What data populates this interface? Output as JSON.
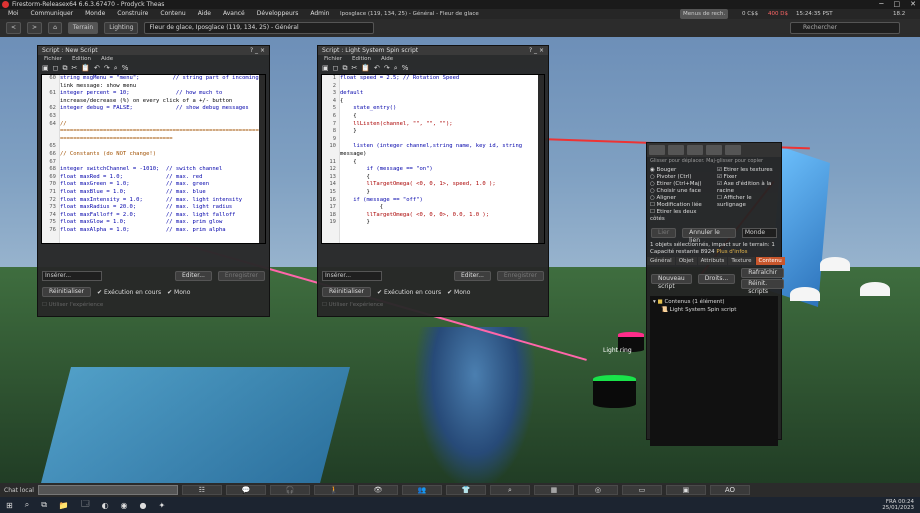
{
  "window_title": "Firestorm-Releasex64 6.6.3.67470 - Prodyck Theas",
  "menu": [
    "Moi",
    "Communiquer",
    "Monde",
    "Construire",
    "Contenu",
    "Aide",
    "Avancé",
    "Développeurs",
    "Admin"
  ],
  "status": {
    "region": "Iposglace (119, 134, 25) - Général - Fleur de glace",
    "search_placeholder": "Menus de rech.",
    "balance": "0 C$$",
    "balance2": "400 D$",
    "time": "15:24:35 PST",
    "fps": "18.2"
  },
  "nav": {
    "back": "<",
    "forward": ">",
    "terrain": "Terrain",
    "lighting": "Lighting",
    "location": "Fleur de glace, Iposglace (119, 134, 25) - Général",
    "search": "Rechercher"
  },
  "script1": {
    "title": "Script : New Script",
    "menu": [
      "Fichier",
      "Edition",
      "Aide"
    ],
    "lines": [
      {
        "n": "60",
        "t": "string msgMenu = \"menu\";          // string part of incoming"
      },
      {
        "n": "",
        "t": "link message: show menu"
      },
      {
        "n": "61",
        "t": "integer percent = 10;              // how much to"
      },
      {
        "n": "",
        "t": "increase/decrease (%) on every click of a +/- button"
      },
      {
        "n": "62",
        "t": "integer debug = FALSE;             // show debug messages"
      },
      {
        "n": "63",
        "t": ""
      },
      {
        "n": "64",
        "t": "//"
      },
      {
        "n": "",
        "t": "================================================================"
      },
      {
        "n": "",
        "t": "=================================="
      },
      {
        "n": "65",
        "t": ""
      },
      {
        "n": "66",
        "t": "// Constants (do NOT change!)"
      },
      {
        "n": "67",
        "t": ""
      },
      {
        "n": "68",
        "t": "integer switchChannel = -1010;  // switch channel"
      },
      {
        "n": "69",
        "t": "float maxRed = 1.0;             // max. red"
      },
      {
        "n": "70",
        "t": "float maxGreen = 1.0;           // max. green"
      },
      {
        "n": "71",
        "t": "float maxBlue = 1.0;            // max. blue"
      },
      {
        "n": "72",
        "t": "float maxIntensity = 1.0;       // max. light intensity"
      },
      {
        "n": "73",
        "t": "float maxRadius = 20.0;         // max. light radius"
      },
      {
        "n": "74",
        "t": "float maxFalloff = 2.0;         // max. light falloff"
      },
      {
        "n": "75",
        "t": "float maxGlow = 1.0;            // max. prim glow"
      },
      {
        "n": "76",
        "t": "float maxAlpha = 1.0;           // max. prim alpha"
      }
    ],
    "insert": "Insérer...",
    "edit": "Editer...",
    "save": "Enregistrer",
    "reset": "Réinitialiser",
    "running": "✔ Exécution en cours",
    "mono": "✔ Mono",
    "experience": "☐ Utiliser l'expérience"
  },
  "script2": {
    "title": "Script : Light System Spin script",
    "menu": [
      "Fichier",
      "Edition",
      "Aide"
    ],
    "lines": [
      {
        "n": "1",
        "t": "float speed = 2.5; // Rotation Speed"
      },
      {
        "n": "2",
        "t": ""
      },
      {
        "n": "3",
        "t": "default"
      },
      {
        "n": "4",
        "t": "{"
      },
      {
        "n": "5",
        "t": "    state_entry()"
      },
      {
        "n": "6",
        "t": "    {"
      },
      {
        "n": "7",
        "t": "    llListen(channel, \"\", \"\", \"\");"
      },
      {
        "n": "8",
        "t": "    }"
      },
      {
        "n": "9",
        "t": ""
      },
      {
        "n": "10",
        "t": "    listen (integer channel,string name, key id, string"
      },
      {
        "n": "",
        "t": "message)"
      },
      {
        "n": "11",
        "t": "    {"
      },
      {
        "n": "12",
        "t": "        if (message == \"on\")"
      },
      {
        "n": "13",
        "t": "        {"
      },
      {
        "n": "14",
        "t": "        llTargetOmega( <0, 0, 1>, speed, 1.0 );"
      },
      {
        "n": "15",
        "t": "        }"
      },
      {
        "n": "16",
        "t": "    if (message == \"off\")"
      },
      {
        "n": "17",
        "t": "            {"
      },
      {
        "n": "18",
        "t": "        llTargetOmega( <0, 0, 0>, 0.0, 1.0 );"
      },
      {
        "n": "19",
        "t": "        }"
      }
    ],
    "insert": "Insérer...",
    "edit": "Editer...",
    "save": "Enregistrer",
    "reset": "Réinitialiser",
    "running": "✔ Exécution en cours",
    "mono": "✔ Mono",
    "experience": "☐ Utiliser l'expérience"
  },
  "build": {
    "title": "?",
    "hint": "Glisser pour déplacer. Maj-glisser pour copier",
    "options": [
      "◉ Bouger",
      "○ Pivoter (Ctrl)",
      "○ Etirer (Ctrl+Maj)",
      "○ Choisir une face",
      "○ Aligner",
      "☐ Modification liée",
      "☐ Etirer les deux côtés",
      "☑ Etirer les textures",
      "☑ Fixer",
      "☑ Axe d'édition à la racine",
      "☐ Afficher le surlignage"
    ],
    "link_btn": "Lier",
    "unlink_btn": "Annuler le lien",
    "grid": "Monde",
    "info": "1 objets sélectionnés, impact sur le terrain: 1",
    "capacity": "Capacité restante 8924",
    "more_info": "Plus d'infos",
    "tabs": [
      "Général",
      "Objet",
      "Attributs",
      "Texture",
      "Contenu"
    ],
    "new_script": "Nouveau script",
    "rights": "Droits...",
    "refresh": "Rafraîchir",
    "reset_scripts": "Réinit. scripts",
    "folder": "Contenus (1 élément)",
    "item": "Light System Spin script"
  },
  "scene": {
    "ring_label": "Light ring"
  },
  "bottombar": {
    "chat": "Chat local",
    "ao": "AO"
  },
  "taskbar": {
    "lang": "FRA",
    "time": "00:24",
    "date": "25/01/2023"
  }
}
